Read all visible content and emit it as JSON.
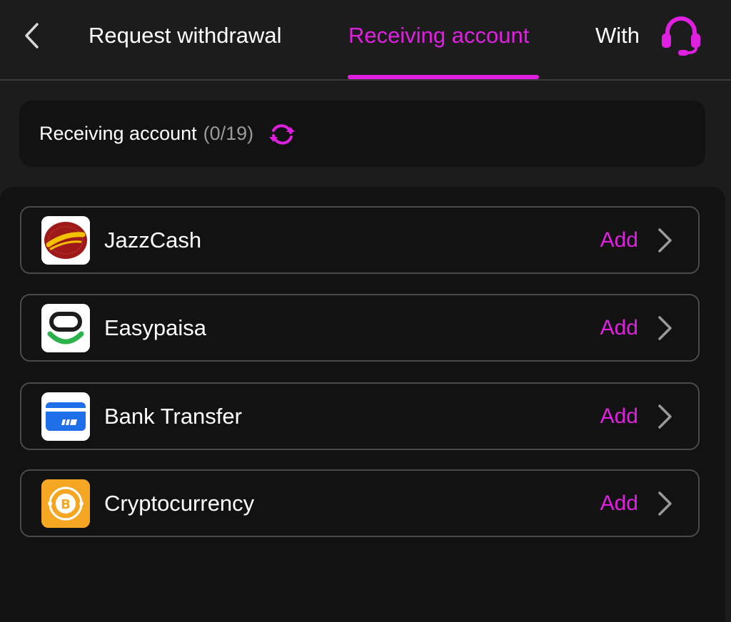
{
  "header": {
    "tabs": [
      {
        "label": "Request withdrawal"
      },
      {
        "label": "Receiving account"
      },
      {
        "label": "Withdrawal record"
      }
    ]
  },
  "summary": {
    "label": "Receiving account",
    "count": "(0/19)"
  },
  "methods": [
    {
      "name": "JazzCash",
      "action": "Add",
      "icon": "jazzcash-logo"
    },
    {
      "name": "Easypaisa",
      "action": "Add",
      "icon": "easypaisa-logo"
    },
    {
      "name": "Bank Transfer",
      "action": "Add",
      "icon": "bank-card-icon"
    },
    {
      "name": "Cryptocurrency",
      "action": "Add",
      "icon": "bitcoin-icon"
    }
  ],
  "colors": {
    "accent": "#e020e0",
    "background": "#1c1c1d",
    "panel": "#121212"
  }
}
